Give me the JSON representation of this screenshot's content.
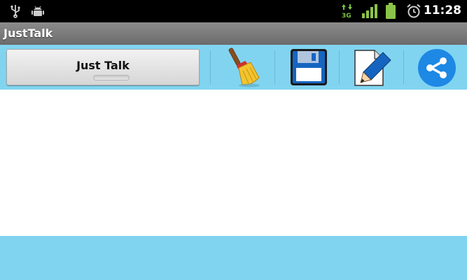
{
  "status_bar": {
    "time": "11:28",
    "network_type": "3G",
    "icons": [
      "usb-icon",
      "android-debug-icon",
      "data-transfer-icon",
      "signal-icon",
      "battery-icon",
      "alarm-icon"
    ]
  },
  "app": {
    "title": "JustTalk"
  },
  "toolbar": {
    "main_button_label": "Just Talk",
    "tools": [
      "broom-icon",
      "save-icon",
      "edit-icon",
      "share-icon"
    ]
  },
  "colors": {
    "toolbar_bg": "#81d4f0",
    "title_bar_bg": "#7a7a7a",
    "status_bar_bg": "#000000",
    "share_blue": "#1e88e5",
    "battery_green": "#8bc34a"
  }
}
